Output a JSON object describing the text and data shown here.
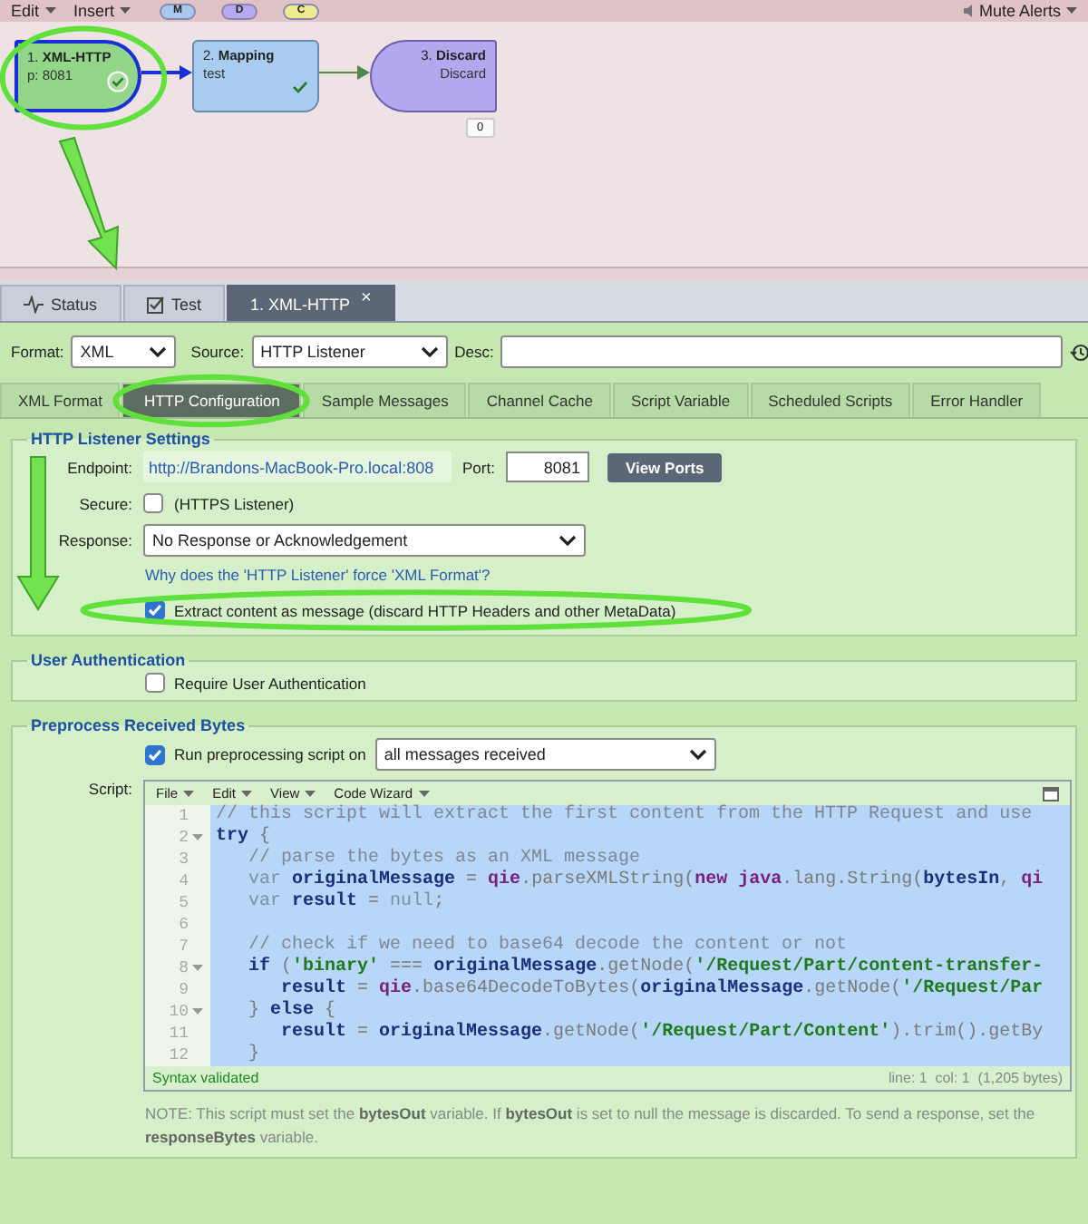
{
  "menu_bar": {
    "menus": [
      "Edit",
      "Insert"
    ],
    "filters": [
      {
        "label": "M",
        "color": "#a8c8ec"
      },
      {
        "label": "D",
        "color": "#b6a9ee"
      },
      {
        "label": "C",
        "color": "#eeeb8e"
      }
    ],
    "alerts": "Mute Alerts"
  },
  "flow": {
    "nodes": [
      {
        "kind": "source",
        "title": "1. **XML-HTTP**",
        "detail": "p: 8081",
        "color": "#93d68a",
        "selected": true,
        "validated": true
      },
      {
        "kind": "mapping",
        "title": "2. **Mapping**",
        "detail": "test",
        "color": "#a9cdf0",
        "selected": false,
        "validated": true
      },
      {
        "kind": "sink",
        "title": "3. **Discard**",
        "detail": "Discard",
        "color": "#b3a8ee",
        "selected": false,
        "count": "0"
      }
    ]
  },
  "tabs": [
    {
      "kind": "status",
      "label": "Status",
      "selected": false
    },
    {
      "kind": "test",
      "label": "Test",
      "selected": false
    },
    {
      "kind": "node",
      "label": "1. XML-HTTP",
      "close": "×",
      "selected": true
    }
  ],
  "format_row": {
    "format": {
      "label": "Format:",
      "value": "XML"
    },
    "source": {
      "label": "Source:",
      "value": "HTTP Listener"
    },
    "desc": {
      "label": "Desc:"
    }
  },
  "sub_tabs": [
    {
      "label": "XML Format",
      "selected": false
    },
    {
      "label": "HTTP Configuration",
      "selected": true
    },
    {
      "label": "Sample Messages",
      "selected": false
    },
    {
      "label": "Channel Cache",
      "selected": false
    },
    {
      "label": "Script Variable",
      "selected": false
    },
    {
      "label": "Scheduled Scripts",
      "selected": false
    },
    {
      "label": "Error Handler",
      "selected": false
    }
  ],
  "http_listener": {
    "title": "HTTP Listener Settings",
    "endpoint": {
      "label": "Endpoint:",
      "value": "http://Brandons-MacBook-Pro.local:808"
    },
    "port": {
      "label": "Port:",
      "value": "8081"
    },
    "view_ports": "View Ports",
    "secure": {
      "label": "Secure:",
      "checked": false,
      "text": "(HTTPS Listener)"
    },
    "response": {
      "label": "Response:",
      "value": "No Response or Acknowledgement"
    },
    "help_link": "Why does the 'HTTP Listener' force 'XML Format'?",
    "extract": {
      "label": "Extract content as message (discard HTTP Headers and other MetaData)",
      "checked": true
    }
  },
  "user_auth": {
    "title": "User Authentication",
    "require": {
      "label": "Require User Authentication",
      "checked": false
    }
  },
  "preprocess": {
    "title": "Preprocess Received Bytes",
    "run": {
      "label": "Run preprocessing script on",
      "checked": true
    },
    "run_on": "all messages received",
    "script_label": "Script:",
    "editor": {
      "menus": [
        "File",
        "Edit",
        "View",
        "Code Wizard"
      ],
      "lines": [
        {
          "number": "1",
          "fold": false,
          "parts": [
            {
              "kind": "comment",
              "text": "// this script will extract the first content from the HTTP Request and use"
            }
          ]
        },
        {
          "number": "2",
          "fold": true,
          "parts": [
            {
              "kind": "keyword",
              "text": "try"
            },
            {
              "kind": "plain",
              "text": " {"
            }
          ]
        },
        {
          "number": "3",
          "fold": false,
          "parts": [
            {
              "kind": "comment",
              "text": "   // parse the bytes as an XML message"
            }
          ]
        },
        {
          "number": "4",
          "fold": false,
          "parts": [
            {
              "kind": "soft",
              "text": "   var "
            },
            {
              "kind": "keyword",
              "text": "originalMessage"
            },
            {
              "kind": "plain",
              "text": " = "
            },
            {
              "kind": "object",
              "text": "qie"
            },
            {
              "kind": "plain",
              "text": ".parseXMLString("
            },
            {
              "kind": "object",
              "text": "new java"
            },
            {
              "kind": "plain",
              "text": ".lang.String("
            },
            {
              "kind": "keyword",
              "text": "bytesIn"
            },
            {
              "kind": "plain",
              "text": ", "
            },
            {
              "kind": "object",
              "text": "qi"
            }
          ]
        },
        {
          "number": "5",
          "fold": false,
          "parts": [
            {
              "kind": "soft",
              "text": "   var "
            },
            {
              "kind": "keyword",
              "text": "result"
            },
            {
              "kind": "plain",
              "text": " = "
            },
            {
              "kind": "soft",
              "text": "null"
            },
            {
              "kind": "plain",
              "text": ";"
            }
          ]
        },
        {
          "number": "6",
          "fold": false
        },
        {
          "number": "7",
          "fold": false,
          "parts": [
            {
              "kind": "comment",
              "text": "   // check if we need to base64 decode the content or not"
            }
          ]
        },
        {
          "number": "8",
          "fold": true,
          "parts": [
            {
              "kind": "keyword",
              "text": "   if"
            },
            {
              "kind": "plain",
              "text": " ("
            },
            {
              "kind": "string",
              "text": "'binary'"
            },
            {
              "kind": "plain",
              "text": " === "
            },
            {
              "kind": "keyword",
              "text": "originalMessage"
            },
            {
              "kind": "plain",
              "text": ".getNode("
            },
            {
              "kind": "string",
              "text": "'/Request/Part/content-transfer-"
            }
          ]
        },
        {
          "number": "9",
          "fold": false,
          "parts": [
            {
              "kind": "keyword",
              "text": "      result"
            },
            {
              "kind": "plain",
              "text": " = "
            },
            {
              "kind": "object",
              "text": "qie"
            },
            {
              "kind": "plain",
              "text": ".base64DecodeToBytes("
            },
            {
              "kind": "keyword",
              "text": "originalMessage"
            },
            {
              "kind": "plain",
              "text": ".getNode("
            },
            {
              "kind": "string",
              "text": "'/Request/Par"
            }
          ]
        },
        {
          "number": "10",
          "fold": true,
          "parts": [
            {
              "kind": "plain",
              "text": "   } "
            },
            {
              "kind": "keyword",
              "text": "else"
            },
            {
              "kind": "plain",
              "text": " {"
            }
          ]
        },
        {
          "number": "11",
          "fold": false,
          "parts": [
            {
              "kind": "keyword",
              "text": "      result"
            },
            {
              "kind": "plain",
              "text": " = "
            },
            {
              "kind": "keyword",
              "text": "originalMessage"
            },
            {
              "kind": "plain",
              "text": ".getNode("
            },
            {
              "kind": "string",
              "text": "'/Request/Part/Content'"
            },
            {
              "kind": "plain",
              "text": ").trim().getBy"
            }
          ]
        },
        {
          "number": "12",
          "fold": false,
          "parts": [
            {
              "kind": "plain",
              "text": "   }"
            }
          ]
        }
      ],
      "status": "Syntax validated",
      "position": "line: 1  col: 1  (1,205 bytes)"
    },
    "note": "NOTE: This script must set the **bytesOut** variable. If **bytesOut** is set to null the message is discarded. To send a response, set the **responseBytes** variable."
  }
}
